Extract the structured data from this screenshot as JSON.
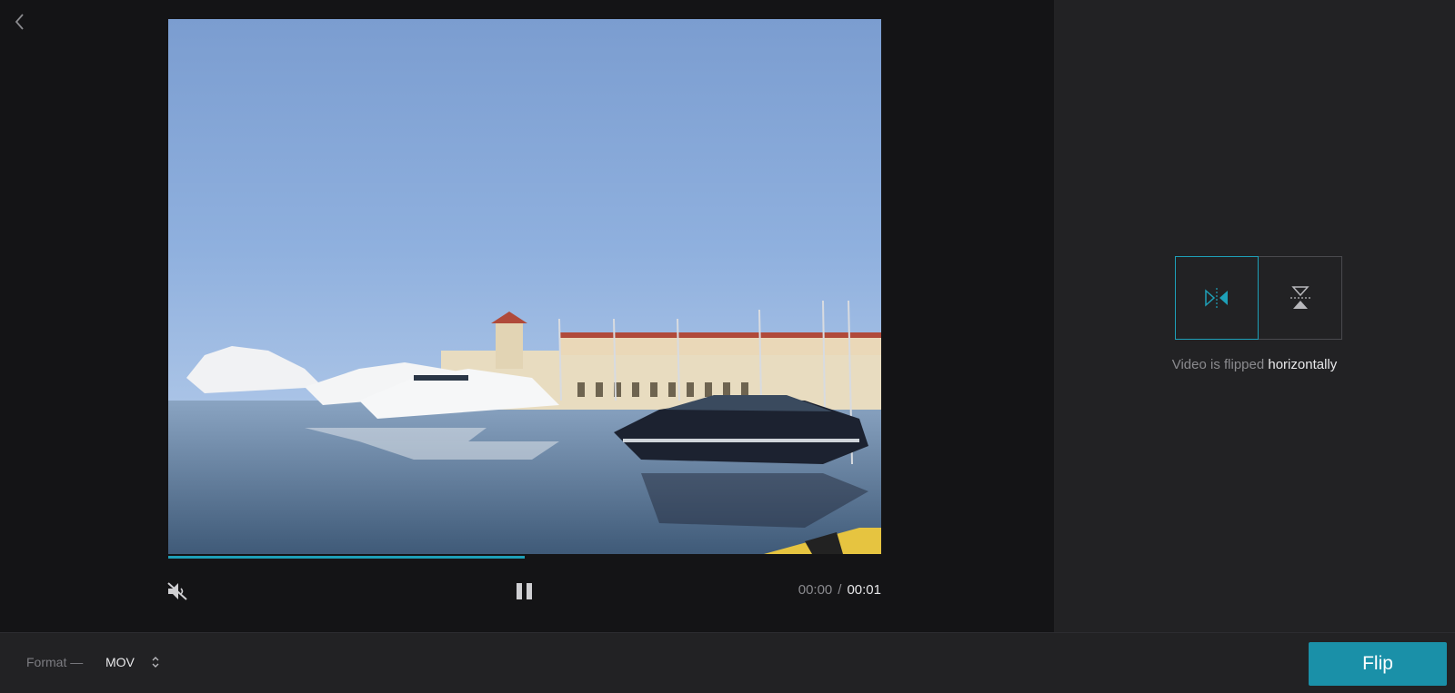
{
  "player": {
    "current_time": "00:00",
    "separator": "/",
    "duration": "00:01",
    "progress_fraction": 0.5,
    "muted": true,
    "state": "playing"
  },
  "flip_panel": {
    "options": [
      {
        "id": "horizontal",
        "icon": "flip-horizontal-icon",
        "active": true
      },
      {
        "id": "vertical",
        "icon": "flip-vertical-icon",
        "active": false
      }
    ],
    "status_prefix": "Video is flipped",
    "status_value": "horizontally"
  },
  "bottom_bar": {
    "format_label": "Format —",
    "format_value": "MOV",
    "flip_button_label": "Flip"
  },
  "colors": {
    "accent": "#1ea0b8",
    "button": "#1a90a8",
    "panel": "#222224",
    "editor_bg": "#141416"
  }
}
